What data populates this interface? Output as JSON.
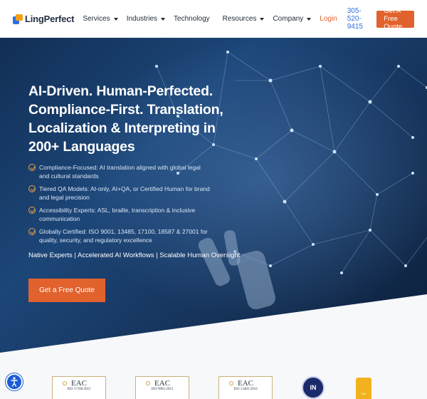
{
  "header": {
    "logo_text": "LingPerfect",
    "nav": [
      {
        "label": "Services",
        "dropdown": true
      },
      {
        "label": "Industries",
        "dropdown": true
      },
      {
        "label": "Technology",
        "dropdown": false
      },
      {
        "label": "Resources",
        "dropdown": true
      },
      {
        "label": "Company",
        "dropdown": true
      }
    ],
    "login": "Login",
    "phone": "305-520-9415",
    "cta": "Get A Free Quote"
  },
  "hero": {
    "title": "AI-Driven. Human-Perfected. Compliance-First. Translation, Localization & Interpreting in 200+ Languages",
    "bullets": [
      "Compliance-Focused: AI translation aligned with global legal and cultural standards",
      "Tiered QA Models: AI-only, AI+QA, or Certified Human for brand and legal precision",
      "Accessibility Experts: ASL, braille, transcription & inclusive communication",
      "Globally Certified: ISO 9001, 13485, 17100, 18587 & 27001 for quality, security, and regulatory excellence"
    ],
    "tagline": "Native Experts | Accelerated AI Workflows | Scalable Human Oversight",
    "cta": "Get a Free Quote"
  },
  "certifications": [
    {
      "brand": "EAC",
      "standard": "ISO 17100:2015"
    },
    {
      "brand": "EAC",
      "standard": "ISO 9001:2015"
    },
    {
      "brand": "EAC",
      "standard": "ISO 13485:2016"
    },
    {
      "label": "IN"
    },
    {
      "label": "ISO"
    }
  ],
  "colors": {
    "accent": "#e1622d",
    "phone": "#2f6fe4",
    "hero_bg": "#17365f"
  }
}
